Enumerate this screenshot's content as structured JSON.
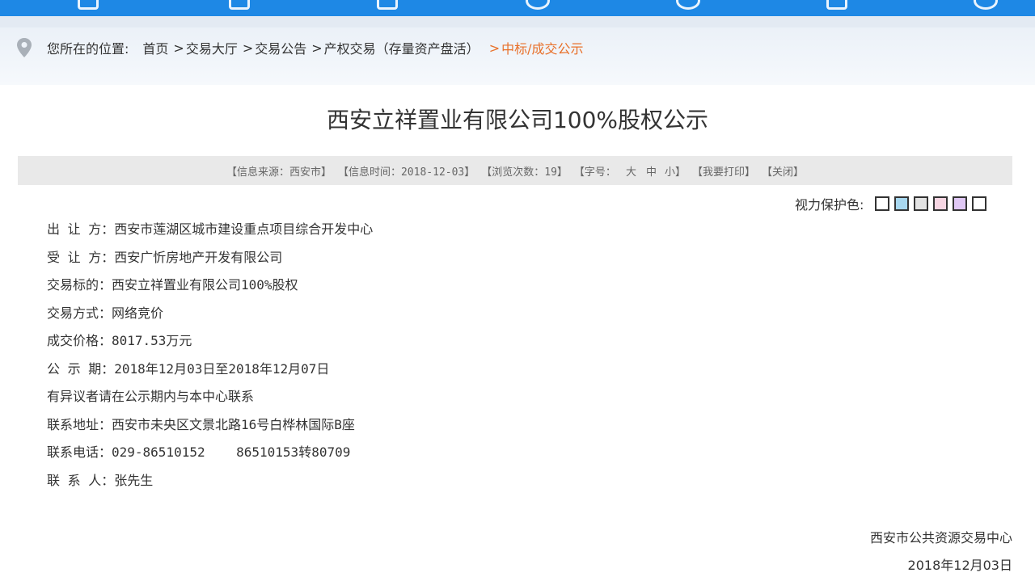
{
  "breadcrumb": {
    "prefix": "您所在的位置:",
    "items": [
      "首页",
      "交易大厅",
      "交易公告",
      "产权交易（存量资产盘活）"
    ],
    "current": "中标/成交公示",
    "separator": ">"
  },
  "article": {
    "title": "西安立祥置业有限公司100%股权公示"
  },
  "info_bar": {
    "source": "【信息来源：西安市】",
    "time": "【信息时间：2018-12-03】",
    "views": "【浏览次数：19】",
    "font_label": "【字号：",
    "font_large": "大",
    "font_medium": "中",
    "font_small": "小】",
    "print": "【我要打印】",
    "close": "【关闭】"
  },
  "vision": {
    "label": "视力保护色:",
    "swatches": [
      "#ffffff",
      "#a8d8f0",
      "#e3e3e3",
      "#f7d6e3",
      "#e0c8f5",
      "#ffffff"
    ]
  },
  "content": {
    "lines": [
      "出 让 方：西安市莲湖区城市建设重点项目综合开发中心",
      "受 让 方：西安广忻房地产开发有限公司",
      "交易标的：西安立祥置业有限公司100%股权",
      "交易方式：网络竞价",
      "成交价格：8017.53万元",
      "公 示 期：2018年12月03日至2018年12月07日",
      "有异议者请在公示期内与本中心联系",
      "联系地址：西安市未央区文景北路16号白桦林国际B座",
      "联系电话：029-86510152    86510153转80709",
      "联 系 人：张先生"
    ]
  },
  "footer": {
    "org": "西安市公共资源交易中心",
    "date": "2018年12月03日"
  }
}
